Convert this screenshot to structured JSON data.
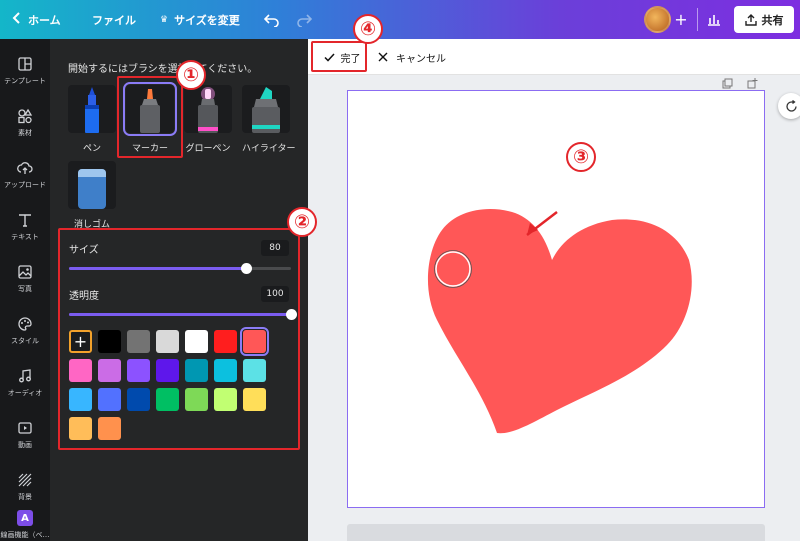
{
  "topbar": {
    "home_label": "ホーム",
    "file_label": "ファイル",
    "resize_label": "サイズを変更",
    "share_label": "共有"
  },
  "rail": {
    "items": [
      {
        "label": "テンプレート",
        "icon": "template-icon"
      },
      {
        "label": "素材",
        "icon": "elements-icon"
      },
      {
        "label": "アップロード",
        "icon": "upload-icon"
      },
      {
        "label": "テキスト",
        "icon": "text-icon"
      },
      {
        "label": "写真",
        "icon": "photo-icon"
      },
      {
        "label": "スタイル",
        "icon": "style-icon"
      },
      {
        "label": "オーディオ",
        "icon": "audio-icon"
      },
      {
        "label": "動画",
        "icon": "video-icon"
      },
      {
        "label": "背景",
        "icon": "background-icon"
      },
      {
        "label": "線画機能（ベ…",
        "icon": "draw-app-icon"
      }
    ]
  },
  "panel": {
    "title": "開始するにはブラシを選択してください。",
    "brushes": [
      {
        "label": "ペン",
        "selected": false
      },
      {
        "label": "マーカー",
        "selected": true
      },
      {
        "label": "グローペン",
        "selected": false
      },
      {
        "label": "ハイライター",
        "selected": false
      },
      {
        "label": "消しゴム",
        "selected": false
      }
    ],
    "size_label": "サイズ",
    "size_value": "80",
    "size_fraction": 0.8,
    "opacity_label": "透明度",
    "opacity_value": "100",
    "opacity_fraction": 1.0,
    "colors": [
      "#000000",
      "#737373",
      "#d9d9d9",
      "#ffffff",
      "#ff1e1e",
      "#ff5757",
      "#ff66c4",
      "#cb6ce6",
      "#8c52ff",
      "#5e17eb",
      "#0097b2",
      "#0cc0df",
      "#5ce1e6",
      "#38b6ff",
      "#5271ff",
      "#004aad",
      "#00bf63",
      "#7ed957",
      "#c1ff72",
      "#ffde59",
      "#ffbd59",
      "#ff914d"
    ],
    "selected_color": "#ff5757"
  },
  "edit_bar": {
    "done_label": "完了",
    "cancel_label": "キャンセル"
  },
  "canvas": {
    "heart_color": "#ff5757"
  },
  "annotations": {
    "badge_1": "①",
    "badge_2": "②",
    "badge_3": "③",
    "badge_4": "④"
  }
}
